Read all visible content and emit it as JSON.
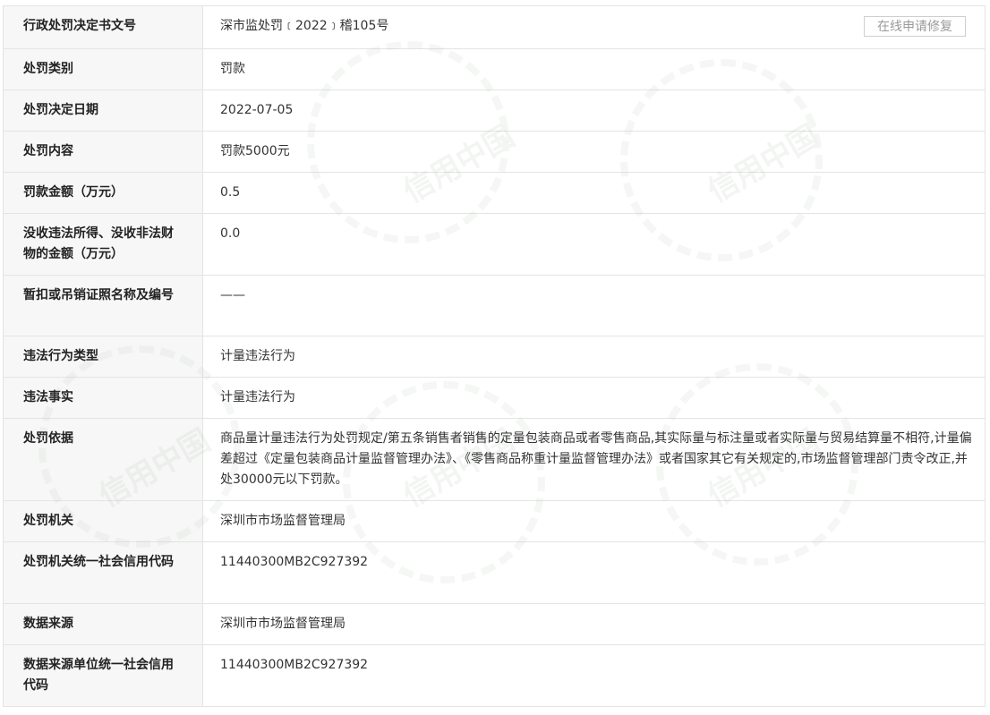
{
  "repair_button": "在线申请修复",
  "watermark_text": "信用中国",
  "rows": [
    {
      "label": "行政处罚决定书文号",
      "value": "深市监处罚﹝2022﹞稽105号"
    },
    {
      "label": "处罚类别",
      "value": "罚款"
    },
    {
      "label": "处罚决定日期",
      "value": "2022-07-05"
    },
    {
      "label": "处罚内容",
      "value": "罚款5000元"
    },
    {
      "label": "罚款金额（万元）",
      "value": "0.5"
    },
    {
      "label": "没收违法所得、没收非法财物的金额（万元）",
      "value": "0.0"
    },
    {
      "label": "暂扣或吊销证照名称及编号",
      "value": "——"
    },
    {
      "label": "违法行为类型",
      "value": "计量违法行为"
    },
    {
      "label": "违法事实",
      "value": "计量违法行为"
    },
    {
      "label": "处罚依据",
      "value": "商品量计量违法行为处罚规定/第五条销售者销售的定量包装商品或者零售商品,其实际量与标注量或者实际量与贸易结算量不相符,计量偏差超过《定量包装商品计量监督管理办法》、《零售商品称重计量监督管理办法》或者国家其它有关规定的,市场监督管理部门责令改正,并处30000元以下罚款。"
    },
    {
      "label": "处罚机关",
      "value": "深圳市市场监督管理局"
    },
    {
      "label": "处罚机关统一社会信用代码",
      "value": "11440300MB2C927392"
    },
    {
      "label": "数据来源",
      "value": "深圳市市场监督管理局"
    },
    {
      "label": "数据来源单位统一社会信用代码",
      "value": "11440300MB2C927392"
    }
  ]
}
